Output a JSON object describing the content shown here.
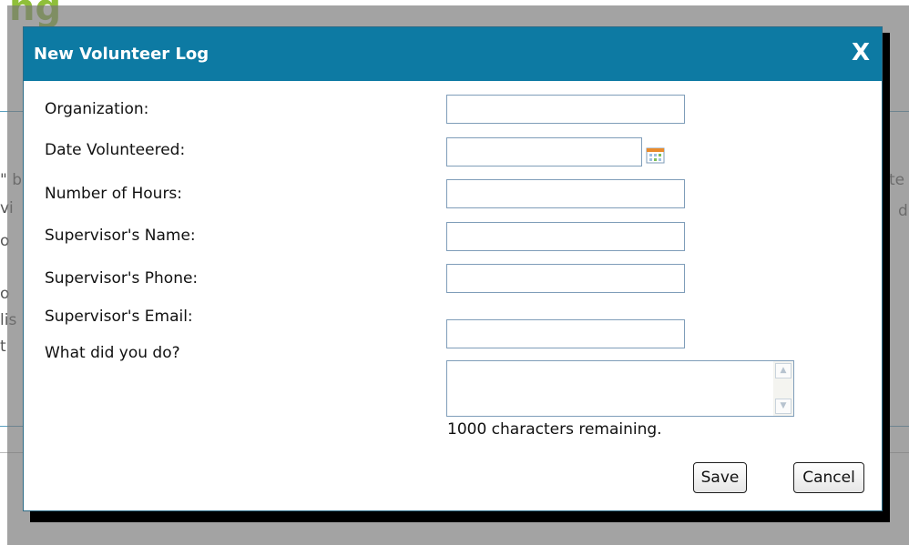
{
  "background": {
    "heading": "ng",
    "left_fragments": [
      "\" b",
      "vi",
      "o",
      "o",
      "lis",
      "t"
    ],
    "right_fragments": [
      "te",
      "d"
    ]
  },
  "dialog": {
    "title": "New Volunteer Log",
    "close_label": "X",
    "fields": {
      "organization": {
        "label": "Organization:",
        "value": ""
      },
      "date_volunteered": {
        "label": "Date Volunteered:",
        "value": ""
      },
      "number_of_hours": {
        "label": "Number of Hours:",
        "value": ""
      },
      "supervisor_name": {
        "label": "Supervisor's Name:",
        "value": ""
      },
      "supervisor_phone": {
        "label": "Supervisor's Phone:",
        "value": ""
      },
      "supervisor_email": {
        "label": "Supervisor's Email:",
        "value": ""
      },
      "what_did_you_do": {
        "label": "What did you do?",
        "value": ""
      }
    },
    "char_remaining": "1000 characters remaining.",
    "save_label": "Save",
    "cancel_label": "Cancel",
    "icons": {
      "calendar": "calendar-icon",
      "scroll_up": "scroll-up-icon",
      "scroll_down": "scroll-down-icon"
    },
    "colors": {
      "header": "#0d7aa3",
      "overlay": "#787878",
      "accent_green": "#8fbf3a"
    }
  }
}
